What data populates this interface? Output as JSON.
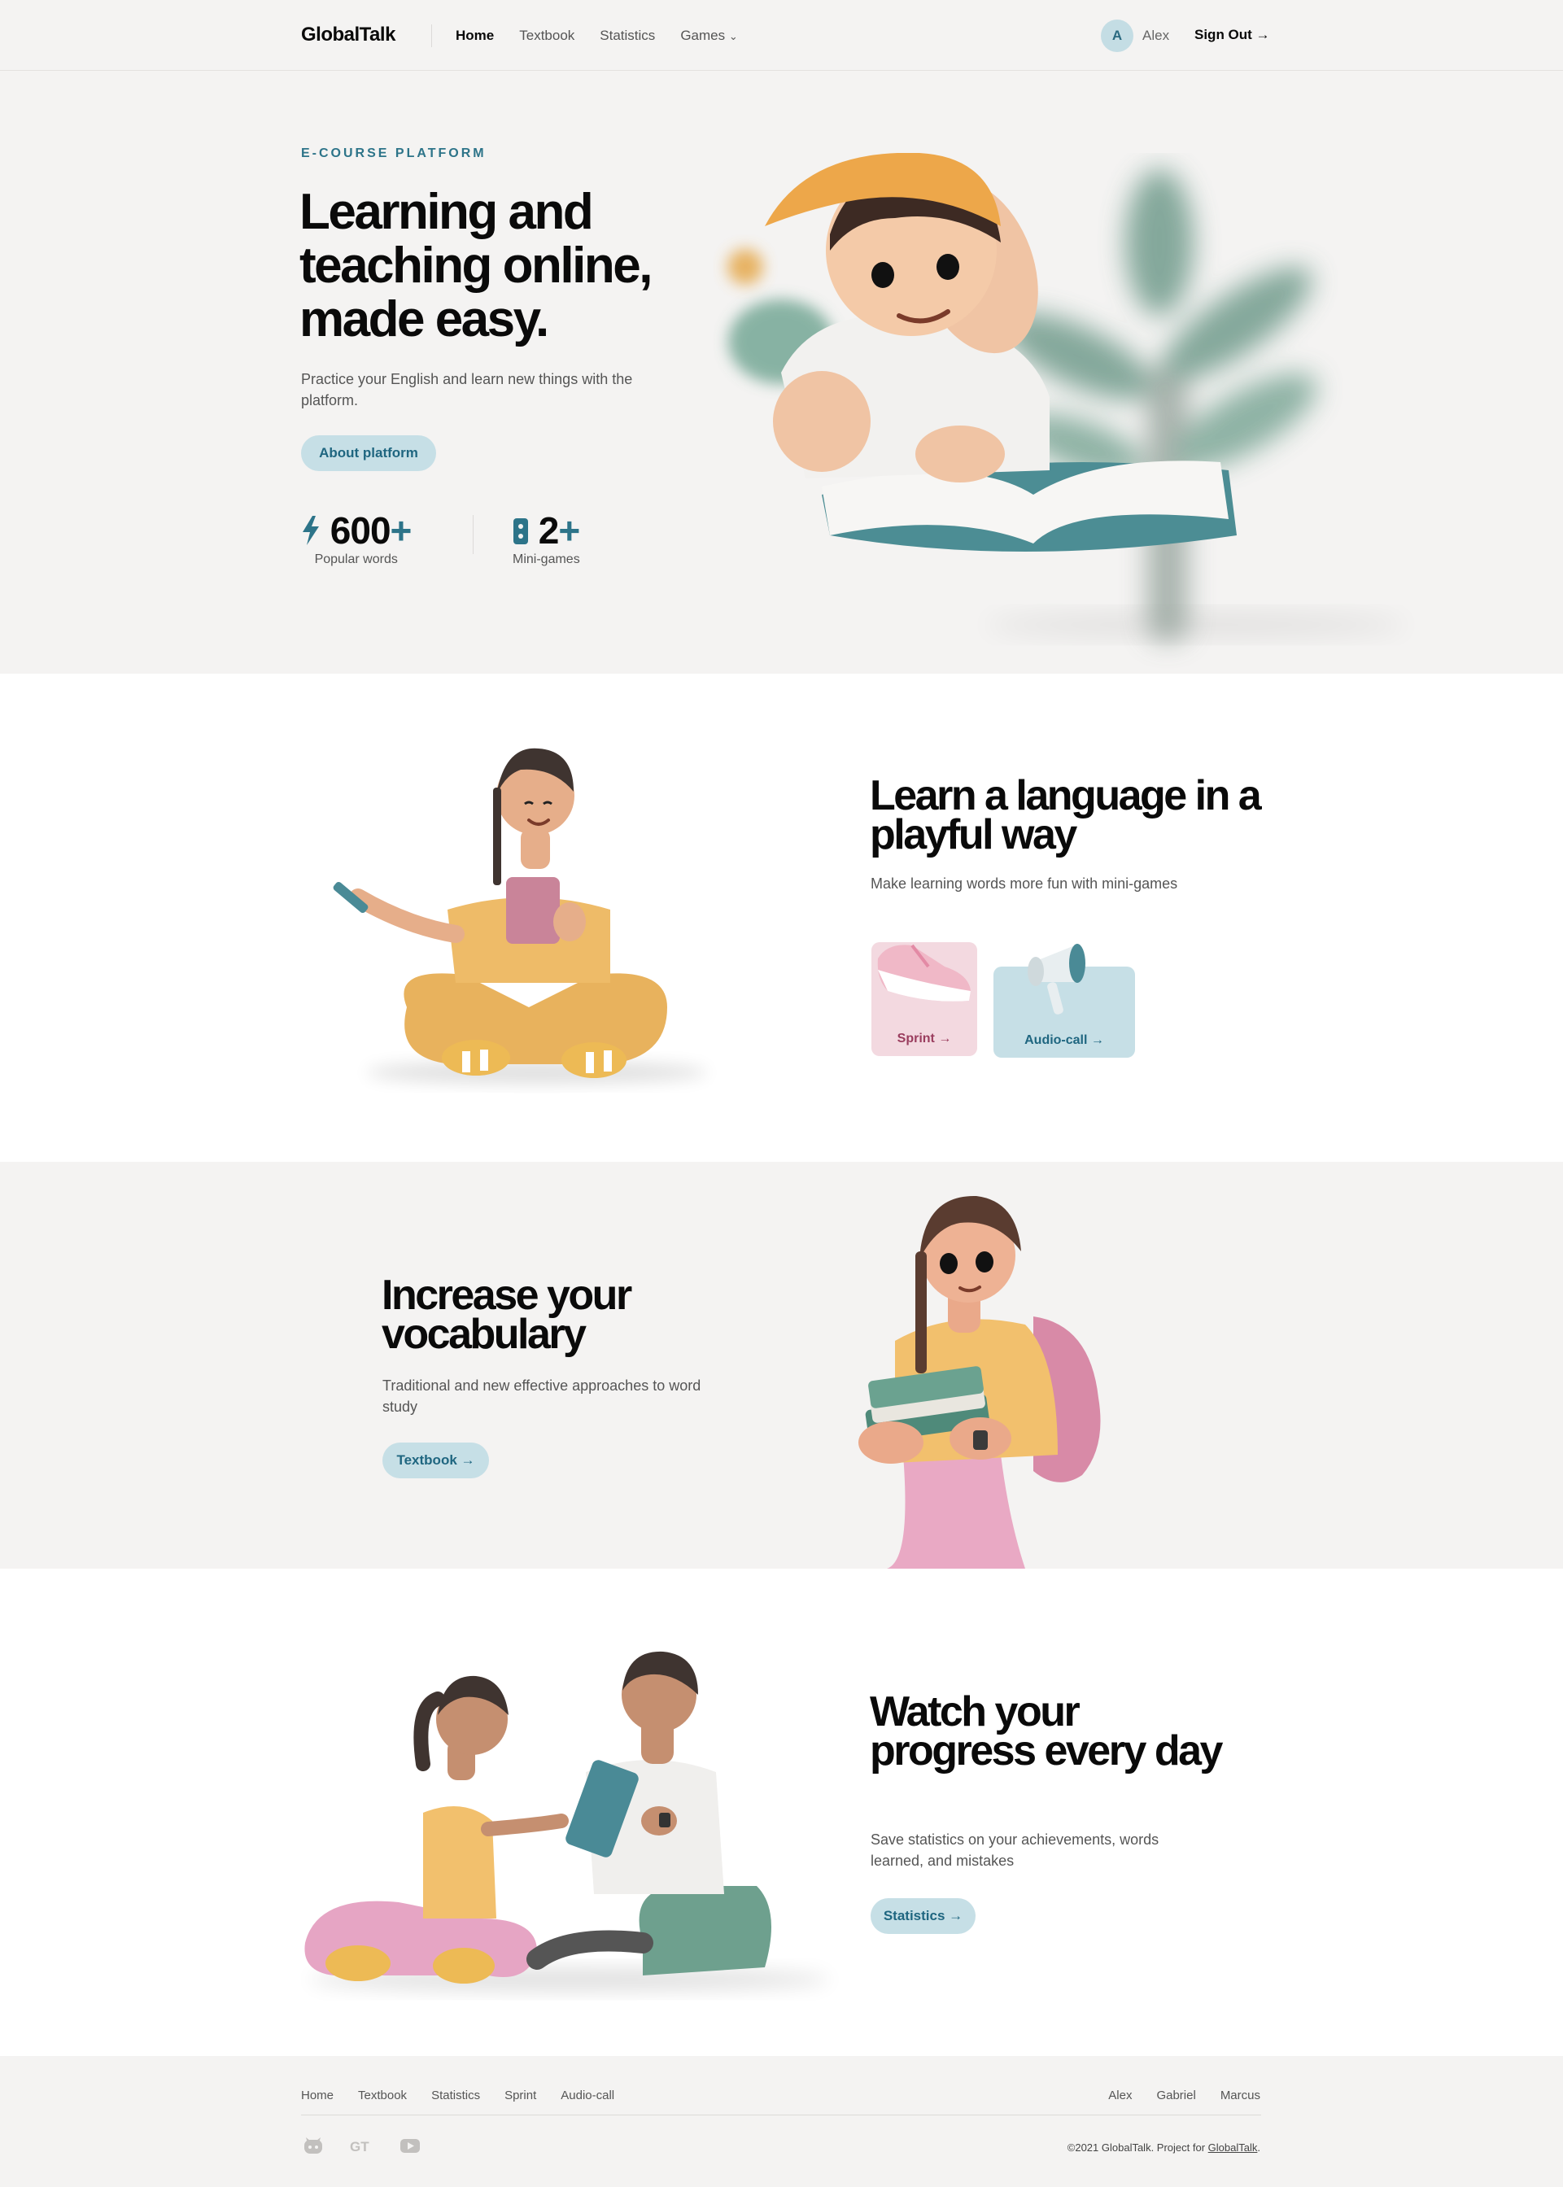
{
  "header": {
    "logo": "GlobalTalk",
    "nav": [
      "Home",
      "Textbook",
      "Statistics",
      "Games"
    ],
    "games_chevron": "⌄",
    "user_initial": "A",
    "user_name": "Alex",
    "signout": "Sign Out →"
  },
  "hero": {
    "eyebrow": "E-COURSE PLATFORM",
    "title": "Learning and teaching online, made easy.",
    "subtitle": "Practice your English and learn new things with the platform.",
    "button": "About platform",
    "stats": [
      {
        "icon": "lightning-icon",
        "value": "600",
        "plus": "+",
        "label": "Popular words"
      },
      {
        "icon": "gamepad-icon",
        "value": "2",
        "plus": "+",
        "label": "Mini-games"
      }
    ]
  },
  "games_section": {
    "title": "Learn a language in a playful way",
    "subtitle": "Make learning words more fun with mini-games",
    "cards": [
      {
        "label": "Sprint →",
        "icon": "sneaker-icon",
        "color": "#f3d9e0"
      },
      {
        "label": "Audio-call →",
        "icon": "megaphone-icon",
        "color": "#c6dfe6"
      }
    ]
  },
  "vocab_section": {
    "title": "Increase your vocabulary",
    "subtitle": "Traditional and new effective approaches to word study",
    "button": "Textbook →"
  },
  "progress_section": {
    "title": "Watch your progress every day",
    "subtitle": "Save statistics on your achievements, words learned, and mistakes",
    "button": "Statistics →"
  },
  "footer": {
    "nav": [
      "Home",
      "Textbook",
      "Statistics",
      "Sprint",
      "Audio-call"
    ],
    "authors": [
      "Alex",
      "Gabriel",
      "Marcus"
    ],
    "copyright": "©2021 GlobalTalk. Project for",
    "copyright_link": "GlobalTalk",
    "copyright_end": ".",
    "icons": [
      "github-icon",
      "gt-logo-icon",
      "youtube-icon"
    ]
  },
  "colors": {
    "accent": "#2d7489",
    "pill": "#c6dfe6",
    "background": "#f4f3f2"
  }
}
